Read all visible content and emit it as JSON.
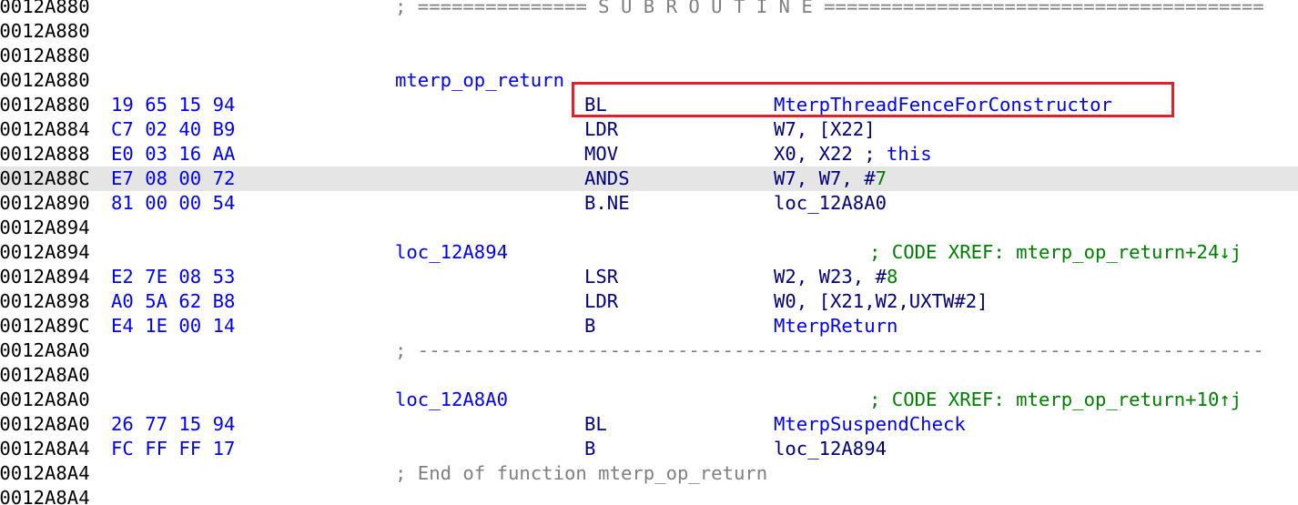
{
  "colors": {
    "address": "#000000",
    "bytes": "#0000ff",
    "mnemonic": "#000080",
    "label": "#0000ff",
    "comment": "#808080",
    "xref": "#008000",
    "immediate": "#008000",
    "current_line_bg": "#e5e5e5",
    "callout_box": "#e0202a"
  },
  "lines": [
    {
      "addr": "00012A880",
      "comment": "; =============== S U B R O U T I N E ======================================="
    },
    {
      "addr": "00012A880"
    },
    {
      "addr": "00012A880"
    },
    {
      "addr": "00012A880",
      "label": "mterp_op_return"
    },
    {
      "addr": "00012A880",
      "bytes": "19 65 15 94",
      "mnem": "BL",
      "op_name": "MterpThreadFenceForConstructor"
    },
    {
      "addr": "00012A884",
      "bytes": "C7 02 40 B9",
      "mnem": "LDR",
      "op": "W7, [X22]"
    },
    {
      "addr": "00012A888",
      "bytes": "E0 03 16 AA",
      "mnem": "MOV",
      "op": "X0, X22 ; ",
      "op_cmt": "this"
    },
    {
      "addr": "00012A88C",
      "bytes": "E7 08 00 72",
      "mnem": "ANDS",
      "op": "W7, W7, #",
      "op_num": "7",
      "highlight": true
    },
    {
      "addr": "00012A890",
      "bytes": "81 00 00 54",
      "mnem": "B.NE",
      "op": "loc_12A8A0"
    },
    {
      "addr": "00012A894"
    },
    {
      "addr": "00012A894",
      "label": "loc_12A894",
      "xref": "; CODE XREF: mterp_op_return+24↓j"
    },
    {
      "addr": "00012A894",
      "bytes": "E2 7E 08 53",
      "mnem": "LSR",
      "op": "W2, W23, #",
      "op_num": "8"
    },
    {
      "addr": "00012A898",
      "bytes": "A0 5A 62 B8",
      "mnem": "LDR",
      "op": "W0, [X21,W2,UXTW#2]"
    },
    {
      "addr": "00012A89C",
      "bytes": "E4 1E 00 14",
      "mnem": "B",
      "op_name": "MterpReturn"
    },
    {
      "addr": "00012A8A0",
      "comment": "; ---------------------------------------------------------------------------"
    },
    {
      "addr": "00012A8A0"
    },
    {
      "addr": "00012A8A0",
      "label": "loc_12A8A0",
      "xref": "; CODE XREF: mterp_op_return+10↑j"
    },
    {
      "addr": "00012A8A0",
      "bytes": "26 77 15 94",
      "mnem": "BL",
      "op_name": "MterpSuspendCheck"
    },
    {
      "addr": "00012A8A4",
      "bytes": "FC FF FF 17",
      "mnem": "B",
      "op": "loc_12A894"
    },
    {
      "addr": "00012A8A4",
      "comment": "; End of function mterp_op_return"
    },
    {
      "addr": "00012A8A4"
    }
  ]
}
